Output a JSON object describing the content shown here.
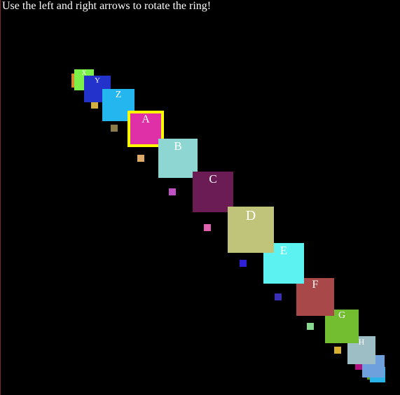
{
  "instructions": "Use the left and right arrows to rotate the ring!",
  "selected_index": 9,
  "ring": [
    {
      "label": "",
      "color": "#2ab3e6"
    },
    {
      "label": "",
      "color": "#6da0dc"
    },
    {
      "label": "H",
      "color": "#9dbec5"
    },
    {
      "label": "G",
      "color": "#72bd30"
    },
    {
      "label": "F",
      "color": "#a84848"
    },
    {
      "label": "E",
      "color": "#5cf2f2"
    },
    {
      "label": "D",
      "color": "#bfc47a"
    },
    {
      "label": "C",
      "color": "#6b1c55"
    },
    {
      "label": "B",
      "color": "#8ed6d2"
    },
    {
      "label": "A",
      "color": "#e030a8"
    },
    {
      "label": "Z",
      "color": "#24b6ee"
    },
    {
      "label": "Y",
      "color": "#2432cc"
    },
    {
      "label": "X",
      "color": "#7cf048"
    },
    {
      "label": "",
      "color": "#d88830"
    }
  ],
  "markers": [
    {
      "color": "#d2b040"
    },
    {
      "color": "#8a7d4a"
    },
    {
      "color": "#ddaa6a"
    },
    {
      "color": "#c050c4"
    },
    {
      "color": "#e060b0"
    },
    {
      "color": "#3020d8"
    },
    {
      "color": "#3a30b8"
    },
    {
      "color": "#88d890"
    },
    {
      "color": "#d8b030"
    },
    {
      "color": "#b01080"
    },
    {
      "color": "#5aa020"
    }
  ]
}
